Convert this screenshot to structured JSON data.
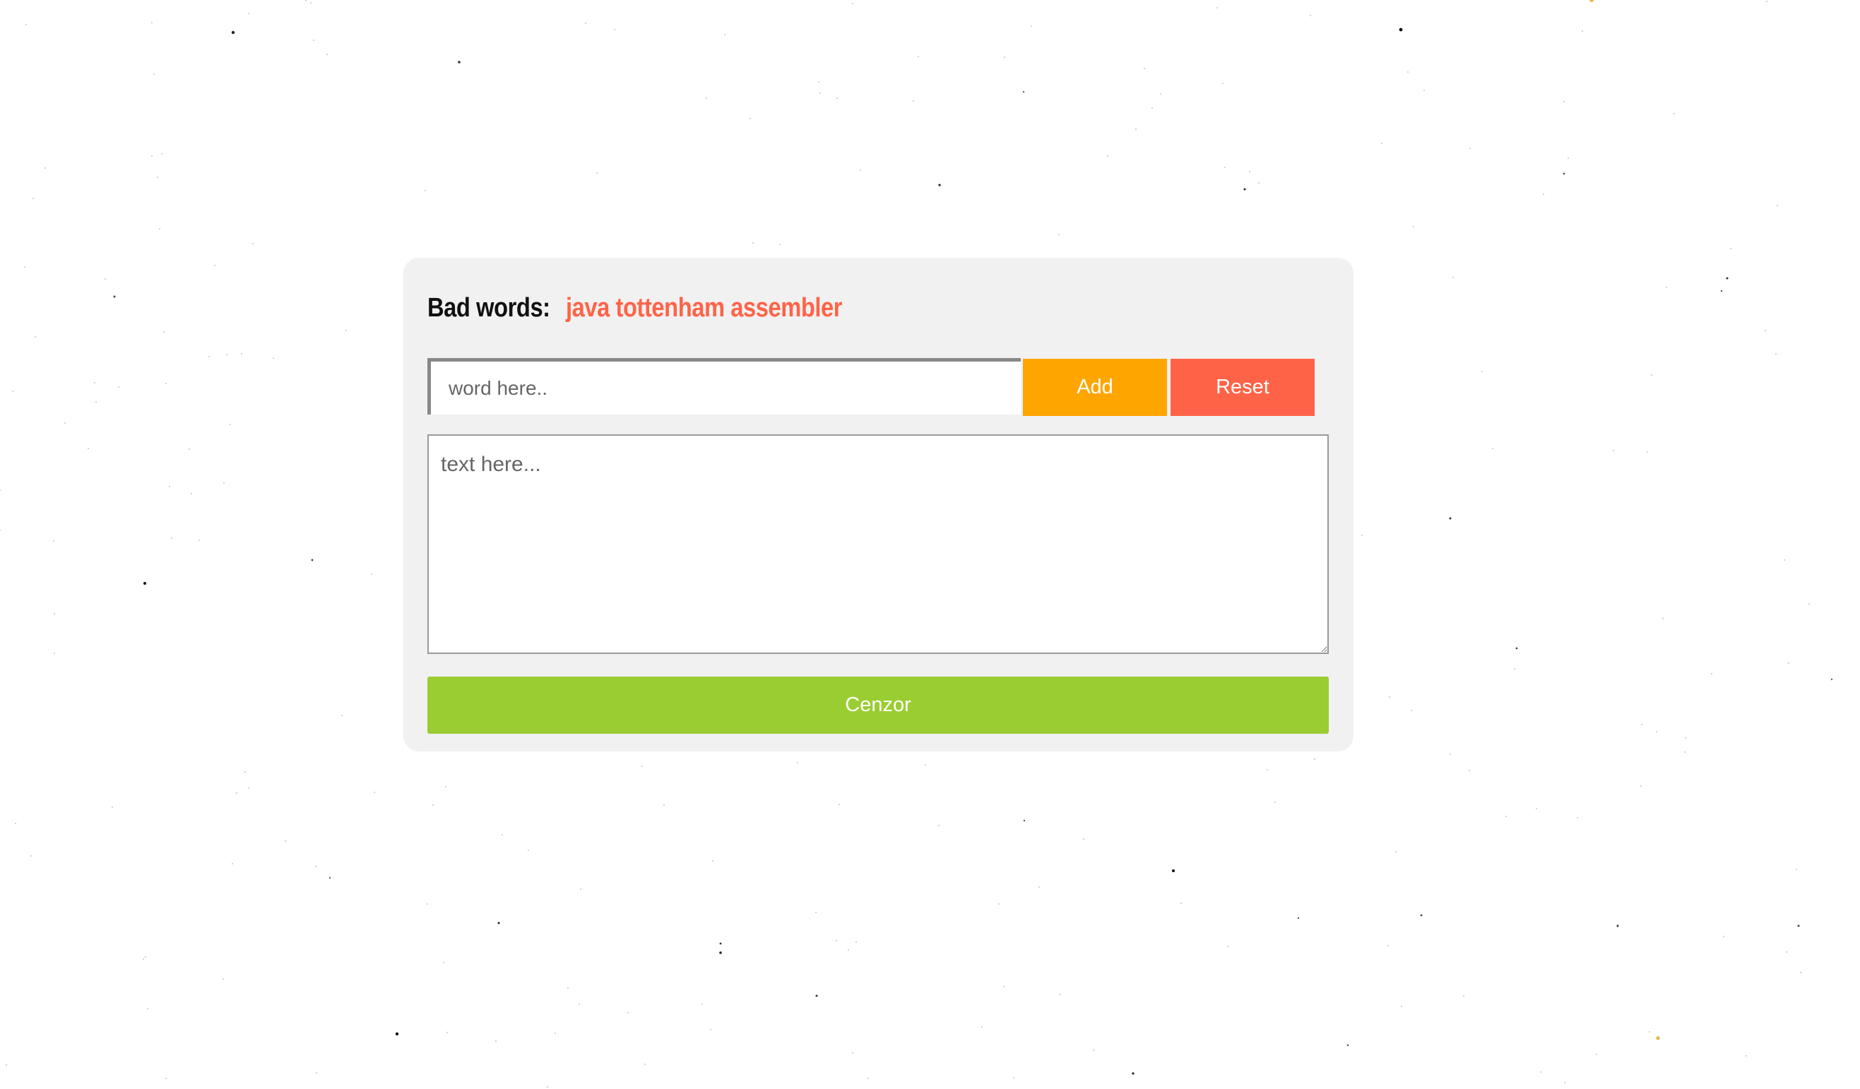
{
  "censor": {
    "bad_words_label": "Bad words:",
    "bad_words_list": "java tottenham assembler",
    "word_input_placeholder": "word here..",
    "add_label": "Add",
    "reset_label": "Reset",
    "text_placeholder": "text here...",
    "cenzor_label": "Cenzor"
  },
  "colors": {
    "add_button": "#ffa500",
    "reset_button": "#ff6347",
    "cenzor_button": "#9acd32",
    "bad_words_text": "#ff6347",
    "card_background": "#f1f1f1"
  }
}
